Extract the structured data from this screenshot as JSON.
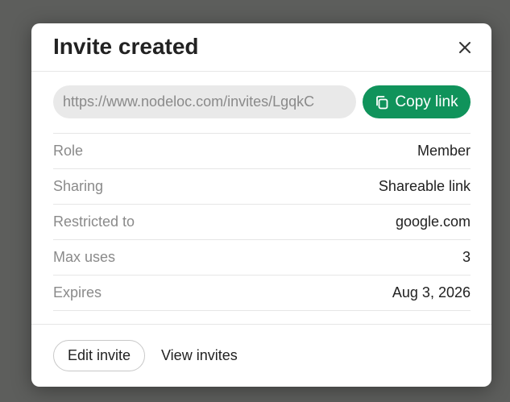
{
  "modal": {
    "title": "Invite created",
    "close_icon": "close-icon"
  },
  "invite_link": {
    "value": "https://www.nodeloc.com/invites/LgqkC",
    "copy_label": "Copy link",
    "copy_icon": "copy-icon"
  },
  "details": [
    {
      "label": "Role",
      "value": "Member"
    },
    {
      "label": "Sharing",
      "value": "Shareable link"
    },
    {
      "label": "Restricted to",
      "value": "google.com"
    },
    {
      "label": "Max uses",
      "value": "3"
    },
    {
      "label": "Expires",
      "value": "Aug 3, 2026"
    }
  ],
  "footer": {
    "edit_label": "Edit invite",
    "view_label": "View invites"
  },
  "colors": {
    "accent": "#10935b",
    "backdrop": "#5d5e5c"
  }
}
